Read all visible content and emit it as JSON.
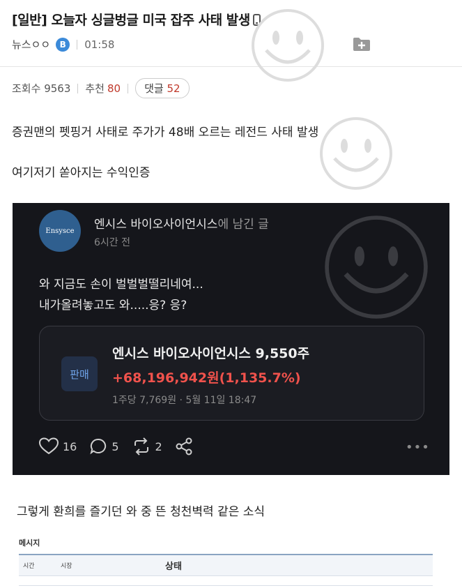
{
  "post": {
    "title": "[일반] 오늘자 싱글벙글 미국 잡주 사태 발생",
    "author": "뉴스ㅇㅇ",
    "badge": "B",
    "time": "01:58",
    "views_label": "조회수",
    "views": "9563",
    "likes_label": "추천",
    "likes": "80",
    "comments_label": "댓글",
    "comments": "52",
    "para1": "증권맨의 펫핑거 사태로 주가가 48배 오르는 레전드 사태 발생",
    "para2": "여기저기 쏟아지는 수익인증",
    "para3": "그렇게 환희를 즐기던 와 중 뜬 청천벽력 같은 소식"
  },
  "screenshot_card": {
    "avatar_text": "Ensysce",
    "author_name": "엔시스 바이오사이언시스",
    "author_suffix": "에 남긴 글",
    "ago": "6시간 전",
    "line1": "와 지금도 손이 벌벌벌떨리네여...",
    "line2": "내가올려놓고도 와.....응? 응?",
    "trade_button": "판매",
    "stock_line": "엔시스 바이오사이언시스 9,550주",
    "profit_line": "+68,196,942원(1,135.7%)",
    "sub_line": "1주당 7,769원 · 5월 11일 18:47",
    "likes": "16",
    "comments": "5",
    "reposts": "2",
    "more": "•••"
  },
  "message_table": {
    "heading": "메시지",
    "col_time": "시간",
    "col_market": "시장",
    "col_status": "상태"
  },
  "colors": {
    "accent_red": "#c0392b",
    "profit_red": "#f0524c",
    "card_bg": "#15161b",
    "badge_blue": "#3b8ad9"
  }
}
